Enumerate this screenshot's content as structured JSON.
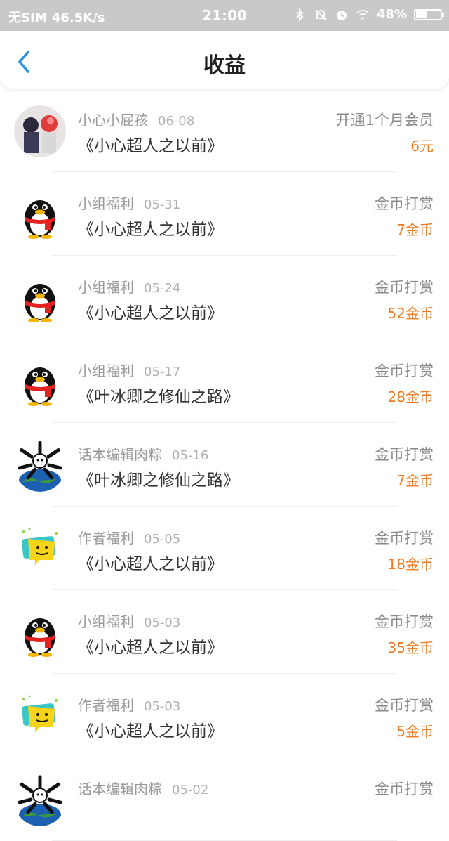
{
  "status_bar": {
    "carrier": "无SIM 46.5K/s",
    "time": "21:00",
    "battery_text": "48%",
    "battery_level": 0.48,
    "icons": [
      "bluetooth-icon",
      "alarm-off-icon",
      "alarm-icon",
      "wifi-icon",
      "battery-icon"
    ]
  },
  "navbar": {
    "back_icon": "chevron-left-icon",
    "title": "收益",
    "accent_color": "#2b8fe0"
  },
  "colors": {
    "amount": "#f07a1f",
    "statusbar_bg": "#c9c9c9"
  },
  "earnings": [
    {
      "name": "小心小屁孩",
      "date": "06-08",
      "book": "《小心超人之以前》",
      "type": "开通1个月会员",
      "amount": "6元",
      "avatar": "anime-avatar"
    },
    {
      "name": "小组福利",
      "date": "05-31",
      "book": "《小心超人之以前》",
      "type": "金币打赏",
      "amount": "7金币",
      "avatar": "qq-penguin-avatar"
    },
    {
      "name": "小组福利",
      "date": "05-24",
      "book": "《小心超人之以前》",
      "type": "金币打赏",
      "amount": "52金币",
      "avatar": "qq-penguin-avatar"
    },
    {
      "name": "小组福利",
      "date": "05-17",
      "book": "《叶冰卿之修仙之路》",
      "type": "金币打赏",
      "amount": "28金币",
      "avatar": "qq-penguin-avatar"
    },
    {
      "name": "话本编辑肉粽",
      "date": "05-16",
      "book": "《叶冰卿之修仙之路》",
      "type": "金币打赏",
      "amount": "7金币",
      "avatar": "globe-panda-avatar"
    },
    {
      "name": "作者福利",
      "date": "05-05",
      "book": "《小心超人之以前》",
      "type": "金币打赏",
      "amount": "18金币",
      "avatar": "emoji-bubble-avatar"
    },
    {
      "name": "小组福利",
      "date": "05-03",
      "book": "《小心超人之以前》",
      "type": "金币打赏",
      "amount": "35金币",
      "avatar": "qq-penguin-avatar"
    },
    {
      "name": "作者福利",
      "date": "05-03",
      "book": "《小心超人之以前》",
      "type": "金币打赏",
      "amount": "5金币",
      "avatar": "emoji-bubble-avatar"
    },
    {
      "name": "话本编辑肉粽",
      "date": "05-02",
      "book": "",
      "type": "金币打赏",
      "amount": "",
      "avatar": "globe-panda-avatar"
    }
  ]
}
